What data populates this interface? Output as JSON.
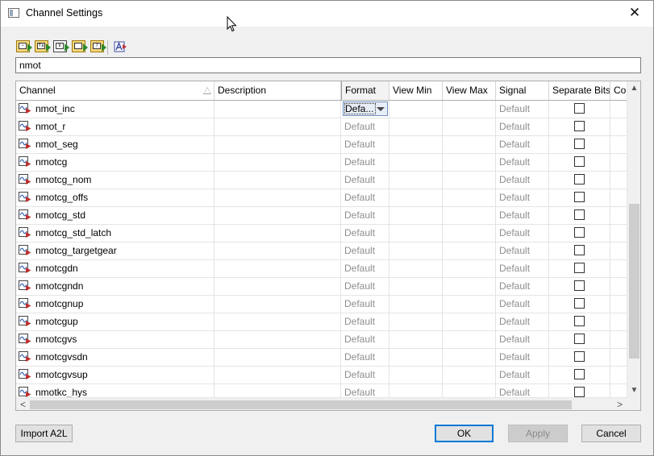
{
  "window": {
    "title": "Channel Settings",
    "close_glyph": "✕"
  },
  "toolbar": {
    "buttons": [
      {
        "icon": "add-channel-icon",
        "glyph": "~"
      },
      {
        "icon": "add-formula-icon",
        "glyph": "fx"
      },
      {
        "icon": "add-variable-icon",
        "glyph": "V"
      },
      {
        "icon": "add-group-icon",
        "glyph": ""
      },
      {
        "icon": "add-unknown-icon",
        "glyph": "?"
      }
    ],
    "text_icon": "font-settings-icon"
  },
  "search": {
    "value": "nmot"
  },
  "table": {
    "columns": [
      "Channel",
      "Description",
      "Format",
      "View Min",
      "View Max",
      "Signal",
      "Separate Bits",
      "Co"
    ],
    "default_label": "Default",
    "combo_value": "Defa...",
    "rows": [
      "nmot_inc",
      "nmot_r",
      "nmot_seg",
      "nmotcg",
      "nmotcg_nom",
      "nmotcg_offs",
      "nmotcg_std",
      "nmotcg_std_latch",
      "nmotcg_targetgear",
      "nmotcgdn",
      "nmotcgndn",
      "nmotcgnup",
      "nmotcgup",
      "nmotcgvs",
      "nmotcgvsdn",
      "nmotcgvsup",
      "nmotkc_hys"
    ]
  },
  "scroll": {
    "up": "▲",
    "down": "▼",
    "left": "<",
    "right": ">"
  },
  "buttons": {
    "import": "Import A2L",
    "ok": "OK",
    "apply": "Apply",
    "cancel": "Cancel"
  },
  "colors": {
    "accent": "#0078d7",
    "toolbar_fill": "#fbd87a"
  }
}
